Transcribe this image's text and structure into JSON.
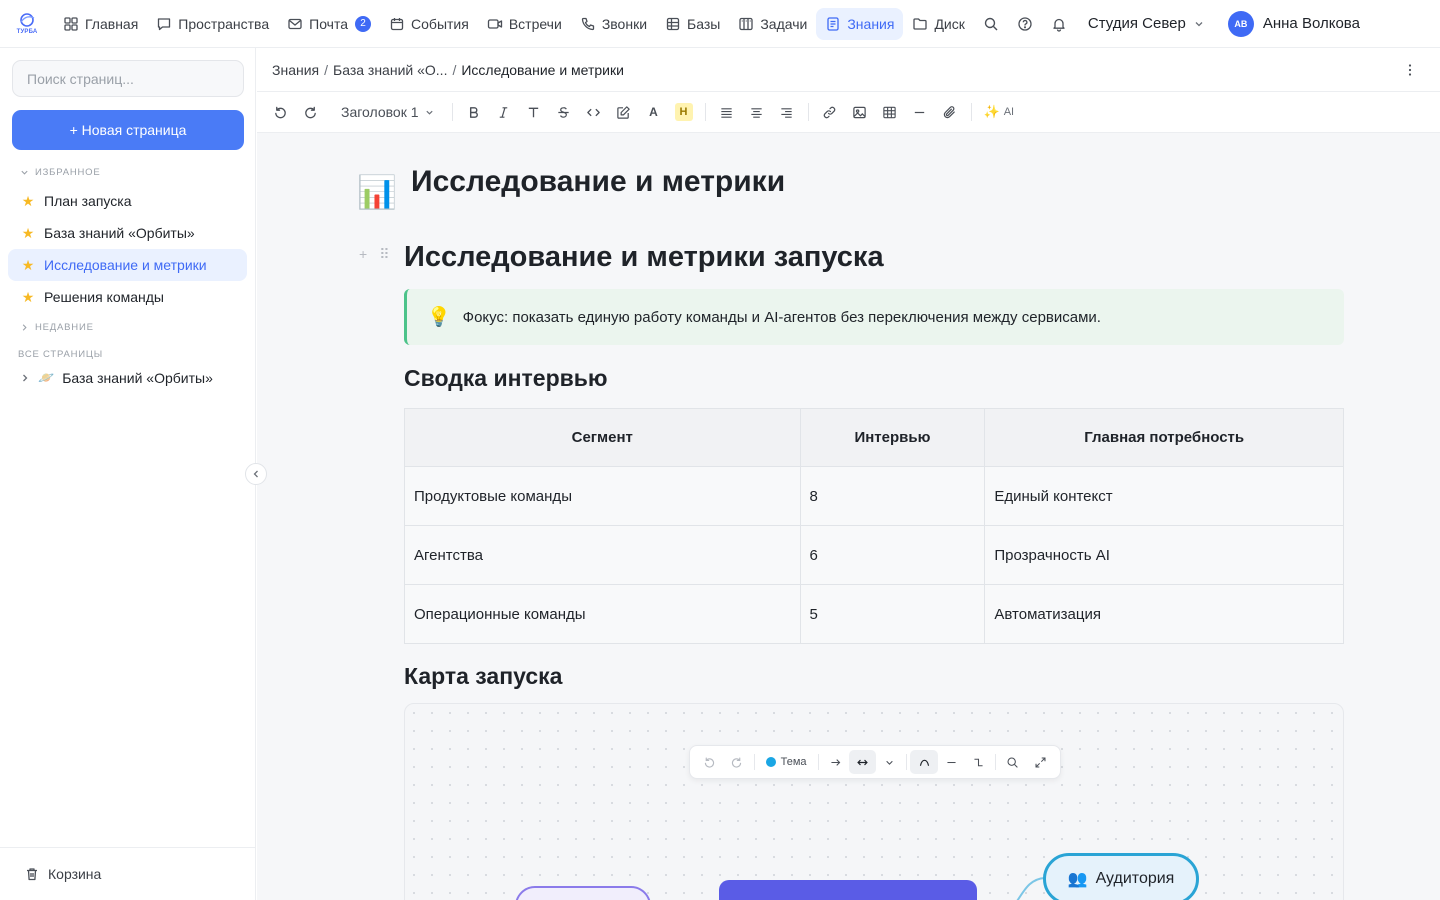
{
  "app": {
    "logo_text": "ТУРБА"
  },
  "nav": {
    "home": "Главная",
    "spaces": "Пространства",
    "mail": "Почта",
    "mail_badge": "2",
    "events": "События",
    "meetings": "Встречи",
    "calls": "Звонки",
    "bases": "Базы",
    "tasks": "Задачи",
    "knowledge": "Знания",
    "disk": "Диск"
  },
  "header": {
    "workspace": "Студия Север",
    "user_initials": "АВ",
    "user_name": "Анна Волкова"
  },
  "sidebar": {
    "search_placeholder": "Поиск страниц...",
    "new_page": "+ Новая страница",
    "favorites_label": "ИЗБРАННОЕ",
    "favorites": [
      {
        "label": "План запуска"
      },
      {
        "label": "База знаний «Орбиты»"
      },
      {
        "label": "Исследование и метрики"
      },
      {
        "label": "Решения команды"
      }
    ],
    "recent_label": "НЕДАВНИЕ",
    "all_pages_label": "ВСЕ СТРАНИЦЫ",
    "tree_emoji": "🪐",
    "tree_item": "База знаний «Орбиты»",
    "trash": "Корзина"
  },
  "breadcrumb": {
    "root": "Знания",
    "parent": "База знаний «О...",
    "current": "Исследование и метрики"
  },
  "toolbar": {
    "heading_select": "Заголовок 1",
    "text_color_label": "A",
    "highlight_label": "H",
    "ai_label": "AI"
  },
  "page": {
    "emoji": "📊",
    "title": "Исследование и метрики",
    "h1": "Исследование и метрики запуска",
    "callout_icon": "💡",
    "callout_text": "Фокус: показать единую работу команды и AI-агентов без переключения между сервисами.",
    "section_interviews": "Сводка интервью",
    "section_map": "Карта запуска"
  },
  "table": {
    "headers": [
      "Сегмент",
      "Интервью",
      "Главная потребность"
    ],
    "rows": [
      [
        "Продуктовые команды",
        "8",
        "Единый контекст"
      ],
      [
        "Агентства",
        "6",
        "Прозрачность AI"
      ],
      [
        "Операционные команды",
        "5",
        "Автоматизация"
      ]
    ]
  },
  "board": {
    "theme_label": "Тема",
    "theme_color": "#1aa6e4",
    "node_audience_icon": "👥",
    "node_audience": "Аудитория"
  },
  "colors": {
    "accent": "#3f6af5",
    "primary_button": "#4a7bf6",
    "callout_border": "#4cc38a",
    "star": "#f7b924"
  }
}
